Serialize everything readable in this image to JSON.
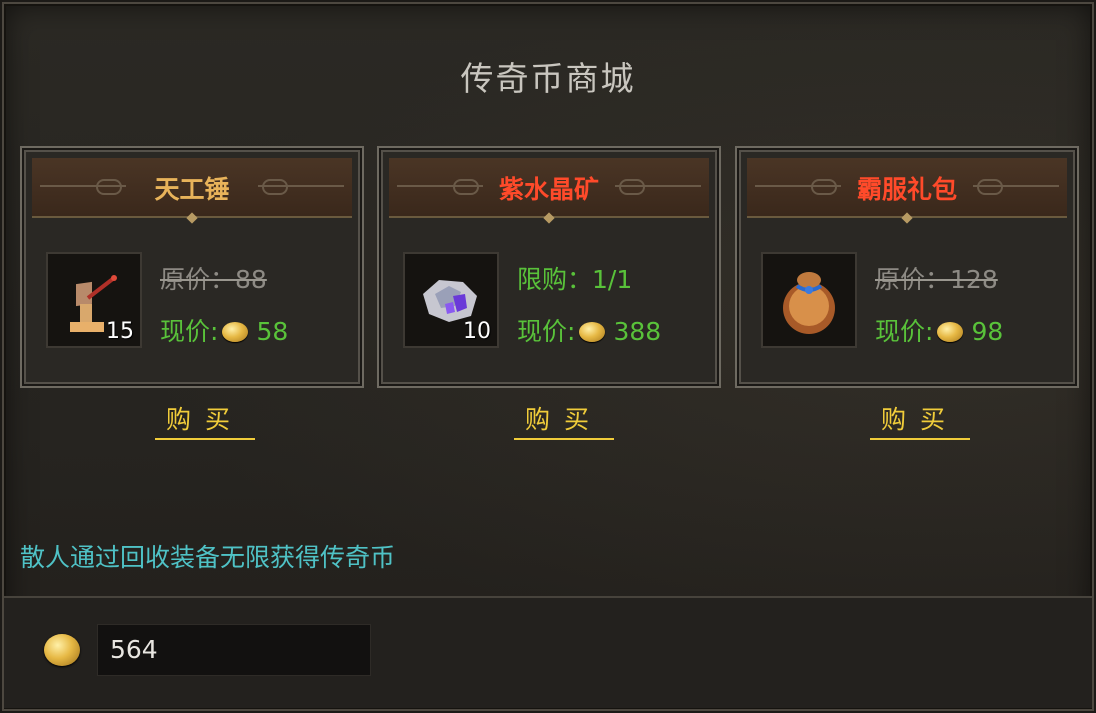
{
  "title": "传奇币商城",
  "items": [
    {
      "name": "天工锤",
      "name_color": "#e8b35a",
      "icon": "hammer-icon",
      "count": "15",
      "line1_label": "原价：",
      "line1_value": "88",
      "price_label": "现价:",
      "price_value": "58",
      "buy_label": "购买"
    },
    {
      "name": "紫水晶矿",
      "name_color": "#ff4a2a",
      "icon": "amethyst-ore-icon",
      "count": "10",
      "line1_label": "限购：",
      "line1_value": "1/1",
      "price_label": "现价:",
      "price_value": "388",
      "buy_label": "购买"
    },
    {
      "name": "霸服礼包",
      "name_color": "#ff4a2a",
      "icon": "gift-bag-icon",
      "count": "",
      "line1_label": "原价：",
      "line1_value": "128",
      "price_label": "现价:",
      "price_value": "98",
      "buy_label": "购买"
    }
  ],
  "promo_text": "散人通过回收装备无限获得传奇币",
  "balance": "564",
  "colors": {
    "promo": "#4fc2c6",
    "price_green": "#59c23a",
    "buy_yellow": "#f0cc3a"
  }
}
